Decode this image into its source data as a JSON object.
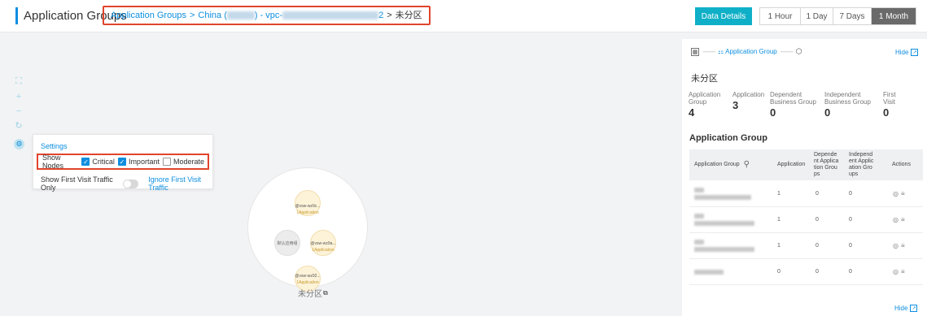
{
  "header": {
    "title": "Application Groups",
    "breadcrumb": {
      "root": "Application Groups",
      "separator": ">",
      "region_prefix": "China (",
      "region_suffix": ") - vpc-",
      "vpc_tail": "2",
      "current": "未分区"
    },
    "data_details_label": "Data Details",
    "time_ranges": [
      {
        "label": "1 Hour",
        "active": false
      },
      {
        "label": "1 Day",
        "active": false
      },
      {
        "label": "7 Days",
        "active": false
      },
      {
        "label": "1 Month",
        "active": true
      }
    ]
  },
  "canvas": {
    "tools": [
      {
        "icon": "fullscreen-icon",
        "glyph": "⛶"
      },
      {
        "icon": "zoom-in-icon",
        "glyph": "+"
      },
      {
        "icon": "zoom-out-icon",
        "glyph": "−"
      },
      {
        "icon": "refresh-icon",
        "glyph": "↻"
      }
    ],
    "settings": {
      "title": "Settings",
      "show_nodes_label": "Show Nodes",
      "options": [
        {
          "label": "Critical",
          "checked": true
        },
        {
          "label": "Important",
          "checked": true
        },
        {
          "label": "Moderate",
          "checked": false
        }
      ],
      "first_visit_label": "Show First Visit Traffic Only",
      "first_visit_on": false,
      "ignore_label": "Ignore First Visit Traffic"
    },
    "graph": {
      "nodes": [
        {
          "name": "@vsw-wz9c...",
          "sub": "1Application"
        },
        {
          "name": "@vsw-wz9a...",
          "sub": "1Application"
        },
        {
          "name": "@vsw-wz92...",
          "sub": "1Application"
        }
      ],
      "default_node": "默认应用组",
      "caption": "未分区"
    }
  },
  "panel": {
    "legend_application_group": "Application Group",
    "hide_label": "Hide",
    "group_name": "未分区",
    "stats": [
      {
        "label": "Application Group",
        "value": "4"
      },
      {
        "label": "Application",
        "value": "3"
      },
      {
        "label": "Dependent Business Group",
        "value": "0"
      },
      {
        "label": "Independent Business Group",
        "value": "0"
      },
      {
        "label": "First Visit",
        "value": "0"
      }
    ],
    "section_title": "Application Group",
    "columns": {
      "group": "Application Group",
      "application": "Application",
      "dependent": "Depende nt Applica tion Grou ps",
      "independent": "Independ ent Applic ation Gro ups",
      "actions": "Actions"
    },
    "rows": [
      {
        "application": "1",
        "dependent": "0",
        "independent": "0"
      },
      {
        "application": "1",
        "dependent": "0",
        "independent": "0"
      },
      {
        "application": "1",
        "dependent": "0",
        "independent": "0"
      },
      {
        "application": "0",
        "dependent": "0",
        "independent": "0"
      }
    ]
  }
}
